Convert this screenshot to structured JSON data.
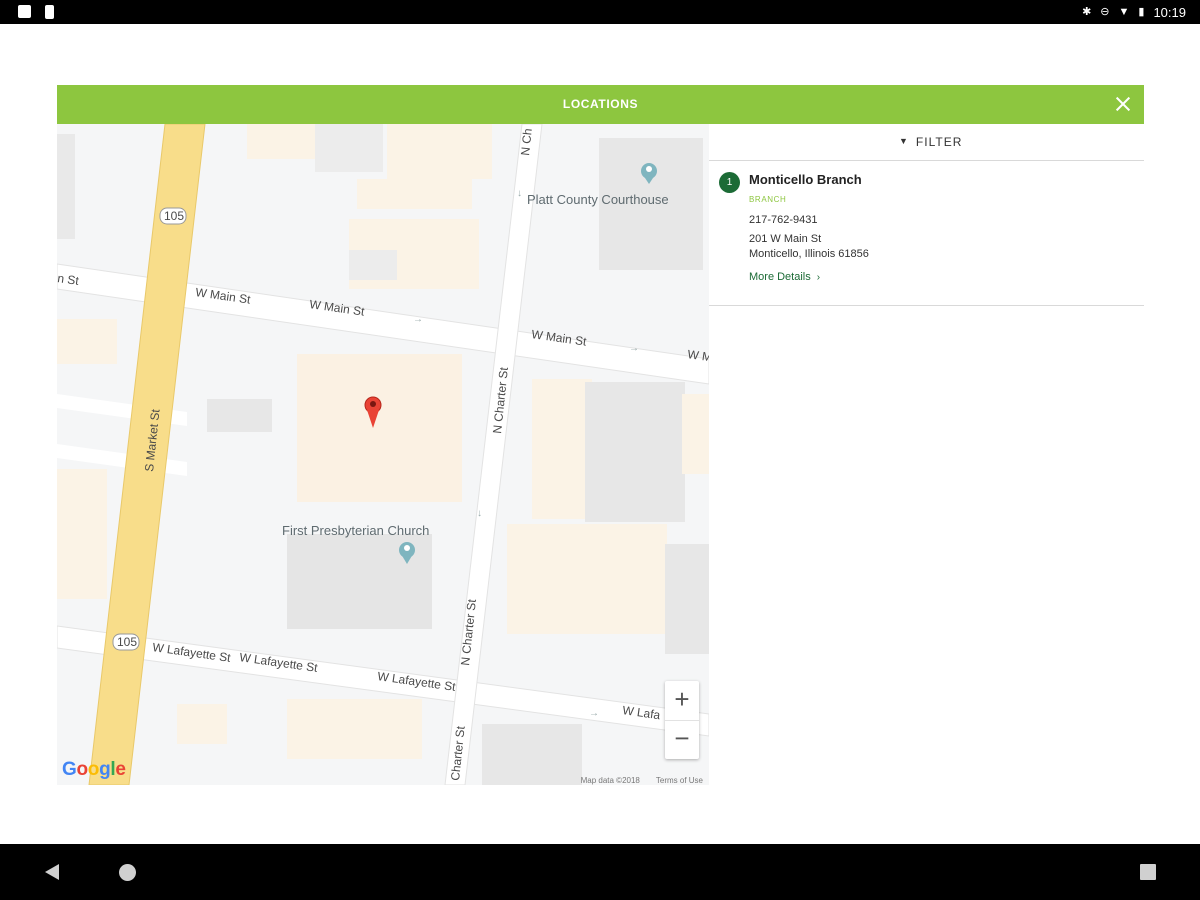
{
  "status_bar": {
    "time": "10:19",
    "left_icons": [
      "image-icon",
      "phone-icon"
    ],
    "right_icons": [
      "bluetooth-icon",
      "do-not-disturb-icon",
      "wifi-icon",
      "battery-icon"
    ]
  },
  "modal": {
    "title": "LOCATIONS",
    "close_icon": "close-icon",
    "header_color": "#8dc63f"
  },
  "map": {
    "streets": {
      "w_main_1": "W Main St",
      "w_main_2": "W Main St",
      "w_main_3": "W Main St",
      "w_main_4": "W Ma",
      "w_main_left": "n St",
      "s_market": "S Market St",
      "n_charter_1": "N Charter St",
      "n_charter_2": "N Charter St",
      "n_charter_3": "Charter St",
      "n_charter_top": "N Ch",
      "w_lafayette_1": "W Lafayette St",
      "w_lafayette_2": "W Lafayette St",
      "w_lafayette_3": "W Lafayette St",
      "w_lafayette_4": "W Lafa",
      "route_1": "105",
      "route_2": "105"
    },
    "pois": {
      "courthouse": "Platt County Courthouse",
      "church": "First Presbyterian Church"
    },
    "zoom_in": "+",
    "zoom_out": "−",
    "logo": [
      "G",
      "o",
      "o",
      "g",
      "l",
      "e"
    ],
    "logo_colors": [
      "#4285f4",
      "#ea4335",
      "#fbbc05",
      "#4285f4",
      "#34a853",
      "#ea4335"
    ],
    "map_data_label": "Map data ©2018",
    "terms_label": "Terms of Use"
  },
  "filter": {
    "label": "FILTER",
    "icon": "chevron-down-icon"
  },
  "locations": [
    {
      "number": "1",
      "name": "Monticello Branch",
      "type": "BRANCH",
      "phone": "217-762-9431",
      "address_line1": "201 W Main St",
      "address_line2": "Monticello, Illinois 61856",
      "more_label": "More Details",
      "more_icon": "chevron-right-icon"
    }
  ],
  "colors": {
    "brand_green": "#8dc63f",
    "dark_green": "#1c6b36"
  },
  "nav_bar": {
    "back_icon": "back-icon",
    "home_icon": "home-icon",
    "recents_icon": "recents-icon"
  }
}
